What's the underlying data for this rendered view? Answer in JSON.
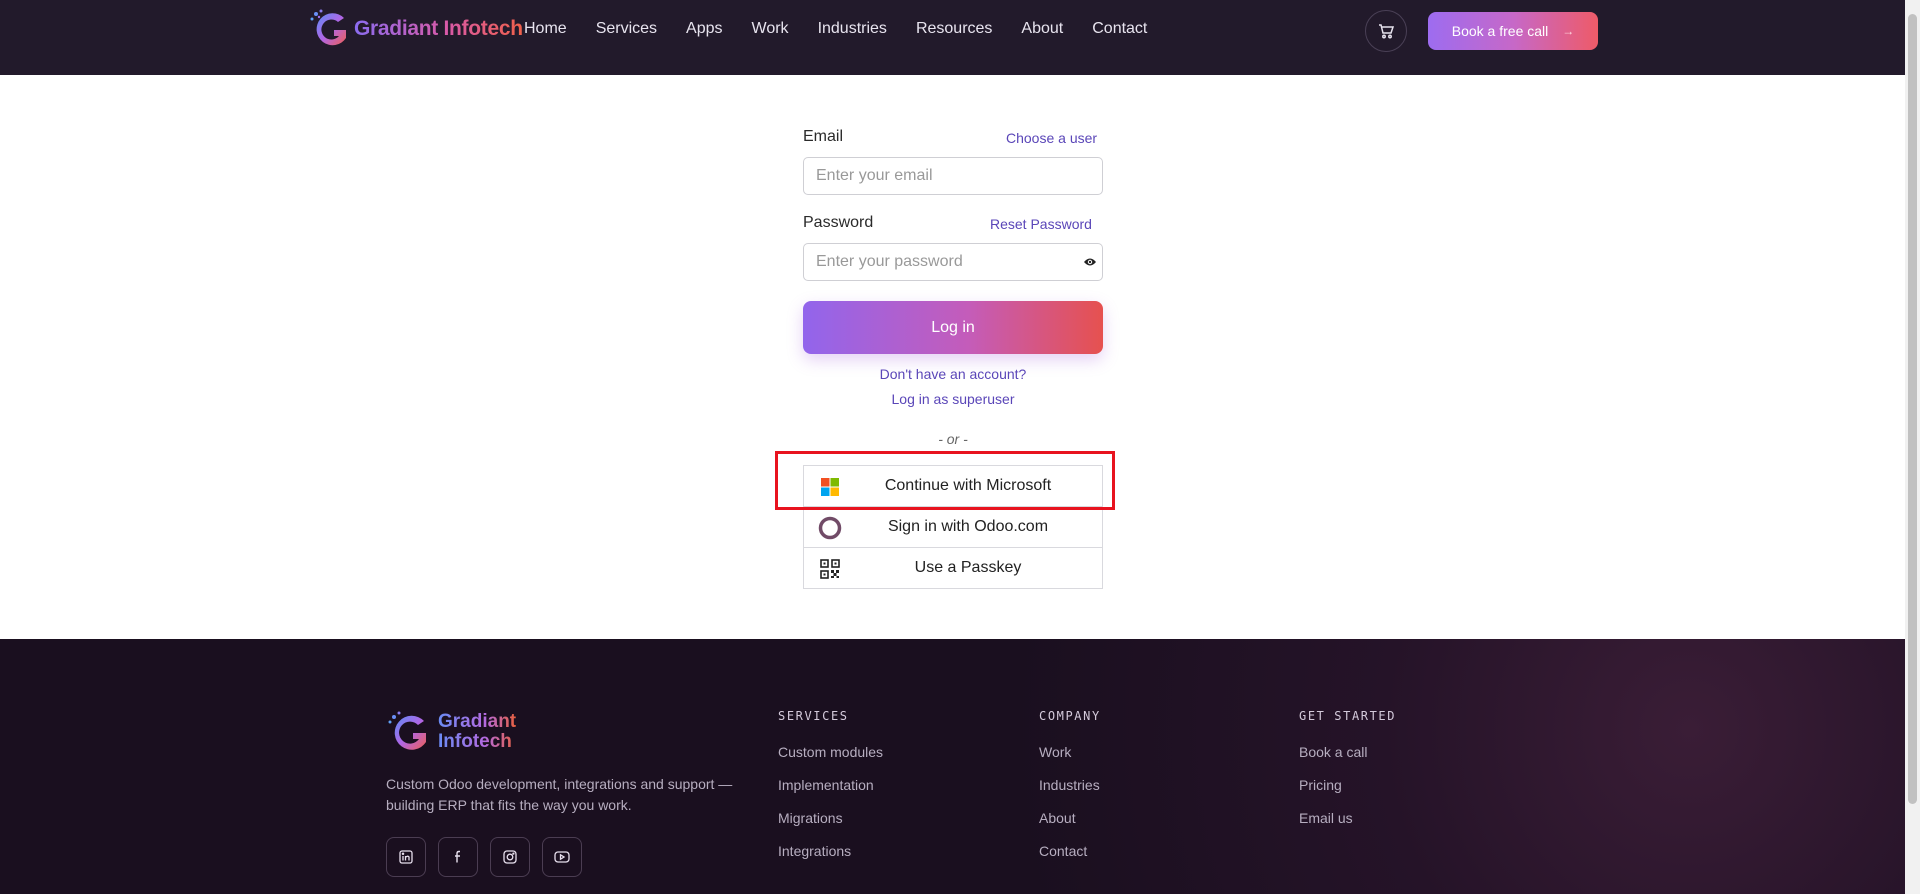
{
  "header": {
    "brand": "Gradiant Infotech",
    "nav": [
      "Home",
      "Services",
      "Apps",
      "Work",
      "Industries",
      "Resources",
      "About",
      "Contact"
    ],
    "cta_label": "Book a free call",
    "cta_arrow": "→"
  },
  "login": {
    "email_label": "Email",
    "choose_user_link": "Choose a user",
    "email_placeholder": "Enter your email",
    "password_label": "Password",
    "reset_password_link": "Reset Password",
    "password_placeholder": "Enter your password",
    "login_button": "Log in",
    "signup_link": "Don't have an account?",
    "superuser_link": "Log in as superuser",
    "or_text": "- or -",
    "oauth": {
      "microsoft": "Continue with Microsoft",
      "odoo": "Sign in with Odoo.com",
      "passkey": "Use a Passkey"
    }
  },
  "footer": {
    "brand_line1": "Gradiant",
    "brand_line2": "Infotech",
    "description": "Custom Odoo development, integrations and support — building ERP that fits the way you work.",
    "services": {
      "heading": "SERVICES",
      "links": [
        "Custom modules",
        "Implementation",
        "Migrations",
        "Integrations"
      ]
    },
    "company": {
      "heading": "COMPANY",
      "links": [
        "Work",
        "Industries",
        "About",
        "Contact"
      ]
    },
    "get_started": {
      "heading": "GET STARTED",
      "links": [
        "Book a call",
        "Pricing",
        "Email us"
      ]
    },
    "social_icons": [
      "linkedin-icon",
      "facebook-icon",
      "instagram-icon",
      "youtube-icon"
    ]
  },
  "colors": {
    "header_bg": "#221a2b",
    "accent_purple": "#9265ec",
    "accent_red": "#e6514f",
    "link": "#5a46b8",
    "highlight": "#e8131f"
  }
}
